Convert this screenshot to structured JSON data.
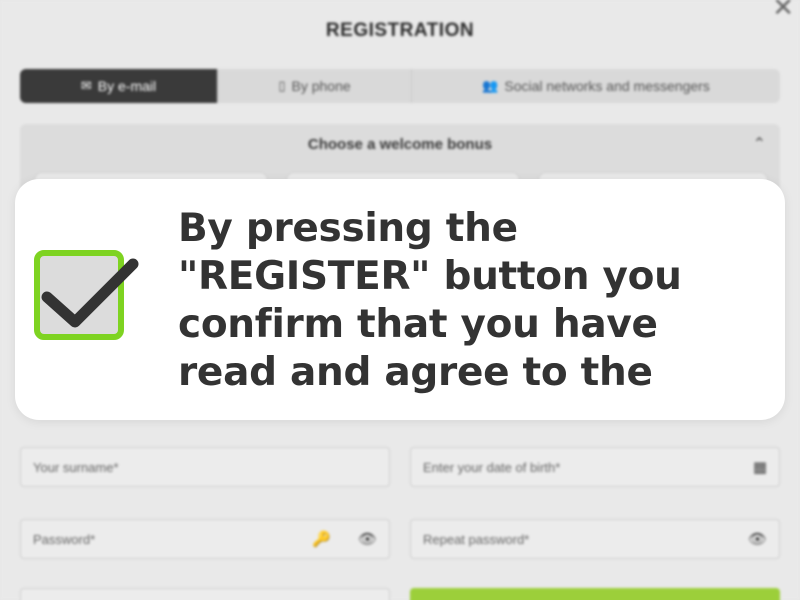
{
  "dialog": {
    "title": "REGISTRATION",
    "close_symbol": "✕"
  },
  "tabs": [
    {
      "label": "By e-mail",
      "icon": "envelope-icon",
      "glyph": "✉",
      "active": true
    },
    {
      "label": "By phone",
      "icon": "phone-icon",
      "glyph": "▯",
      "active": false
    },
    {
      "label": "Social networks and messengers",
      "icon": "people-icon",
      "glyph": "👥",
      "active": false
    }
  ],
  "bonus": {
    "title": "Choose a welcome bonus",
    "chevron": "⌃"
  },
  "fields": {
    "surname_placeholder": "Your surname*",
    "birth_date_placeholder": "Enter your date of birth*",
    "password_placeholder": "Password*",
    "repeat_password_placeholder": "Repeat password*"
  },
  "icons": {
    "calendar": "▦",
    "key": "🔑",
    "eye": "👁"
  },
  "overlay": {
    "message": "By pressing the \"REGISTER\" button you confirm that you have read and agree to the",
    "checkbox_checked": true
  },
  "colors": {
    "accent_green": "#7ed321",
    "active_tab": "#3a3a3a",
    "submit_green": "#9ccf3a",
    "text_dark": "#333333"
  }
}
